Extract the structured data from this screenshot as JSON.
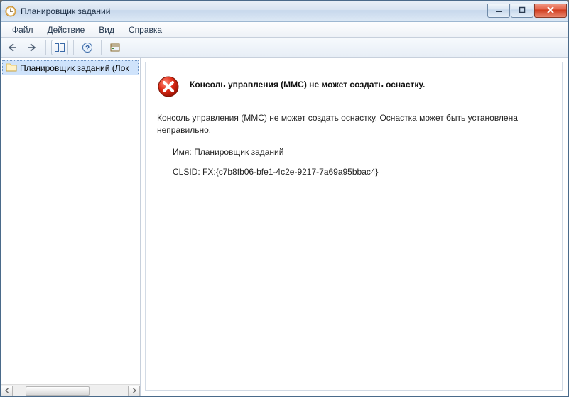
{
  "window": {
    "title": "Планировщик заданий"
  },
  "menu": {
    "file": "Файл",
    "action": "Действие",
    "view": "Вид",
    "help": "Справка"
  },
  "tree": {
    "root": "Планировщик заданий (Лок"
  },
  "error": {
    "heading": "Консоль управления (MMC) не может создать оснастку.",
    "body": "Консоль управления (MMC) не может создать оснастку. Оснастка может быть установлена неправильно.",
    "name_label": "Имя:",
    "name_value": "Планировщик заданий",
    "clsid_label": "CLSID:",
    "clsid_value": "FX:{c7b8fb06-bfe1-4c2e-9217-7a69a95bbac4}"
  }
}
